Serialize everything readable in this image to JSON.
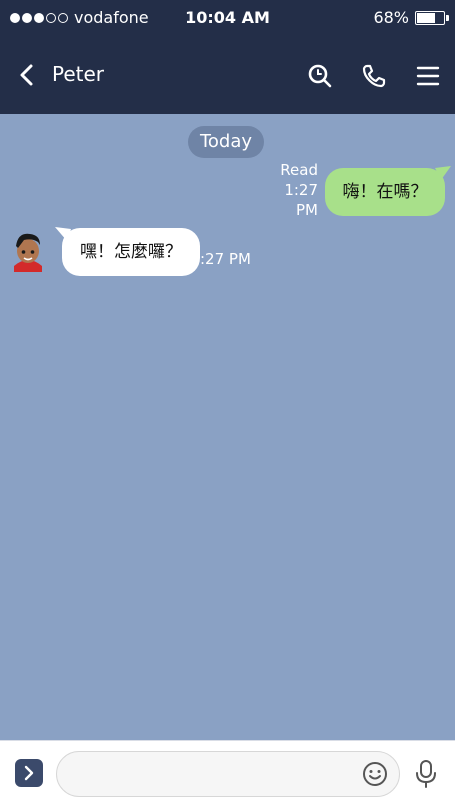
{
  "status_bar": {
    "carrier": "vodafone",
    "signal_bars_filled": 3,
    "signal_bars_total": 5,
    "time": "10:04 AM",
    "battery_percent": "68%",
    "battery_level": 0.68
  },
  "header": {
    "back_icon": "chevron-left-icon",
    "title": "Peter",
    "icons": [
      "search-icon",
      "phone-icon",
      "menu-icon"
    ]
  },
  "chat": {
    "date_label": "Today",
    "messages": [
      {
        "direction": "outgoing",
        "text": "嗨！在嗎？",
        "read_label": "Read",
        "time_line1": "1:27",
        "time_line2": "PM",
        "bubble_color": "#a8e08a"
      },
      {
        "direction": "incoming",
        "text": "嘿！怎麼囉？",
        "time": ":27 PM",
        "bubble_color": "#ffffff"
      }
    ]
  },
  "composer": {
    "placeholder": "",
    "value": "",
    "icons": [
      "expand-icon",
      "emoji-icon",
      "microphone-icon"
    ]
  },
  "colors": {
    "header_bg": "#232e48",
    "chat_bg": "#8aa1c4",
    "date_pill_bg": "#6f84a6"
  }
}
